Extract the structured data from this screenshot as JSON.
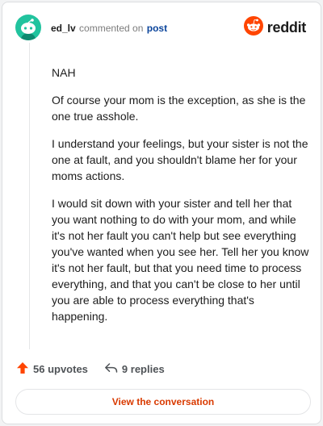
{
  "header": {
    "username": "ed_lv",
    "commented_on": "commented on",
    "post_link": "post",
    "brand": "reddit"
  },
  "comment": {
    "paragraphs": [
      "NAH",
      "Of course your mom is the exception, as she is the one true asshole.",
      "I understand your feelings, but your sister is not the one at fault, and you shouldn't blame her for your moms actions.",
      "I would sit down with your sister and tell her that you want nothing to do with your mom, and while it's not her fault you can't help but see everything you've wanted when you see her. Tell her you know it's not her fault, but that you need time to process everything, and that you can't be close to her until you are able to process everything that's happening."
    ]
  },
  "actions": {
    "upvotes": "56 upvotes",
    "replies": "9 replies"
  },
  "footer": {
    "view_conversation": "View the conversation"
  },
  "colors": {
    "avatar_bg": "#21c39e",
    "reddit_orange": "#ff4500",
    "link_blue": "#0a449b",
    "cta_orange": "#d93a00"
  },
  "icons": [
    "snoo-avatar-icon",
    "reddit-logo-icon",
    "upvote-arrow-icon",
    "reply-arrow-icon"
  ]
}
